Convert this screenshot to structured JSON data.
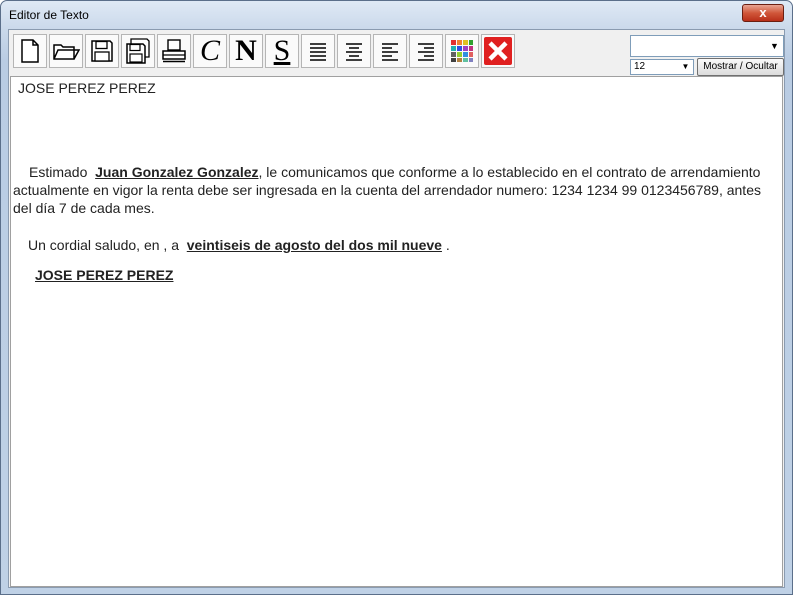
{
  "window": {
    "title": "Editor de Texto",
    "close_label": "x"
  },
  "toolbar": {
    "buttons": [
      {
        "name": "new-document",
        "icon": "new-document-icon"
      },
      {
        "name": "open",
        "icon": "open-folder-icon"
      },
      {
        "name": "save",
        "icon": "floppy-disk-icon"
      },
      {
        "name": "save-as",
        "icon": "save-as-icon"
      },
      {
        "name": "print",
        "icon": "printer-icon"
      },
      {
        "name": "italic",
        "glyph": "C"
      },
      {
        "name": "bold",
        "glyph": "N"
      },
      {
        "name": "underline",
        "glyph": "S"
      },
      {
        "name": "align-justify",
        "icon": "align-justify-icon"
      },
      {
        "name": "align-center",
        "icon": "align-center-icon"
      },
      {
        "name": "align-left",
        "icon": "align-left-icon"
      },
      {
        "name": "align-right",
        "icon": "align-right-icon"
      },
      {
        "name": "color",
        "icon": "color-palette-icon"
      },
      {
        "name": "close-document",
        "icon": "red-x-icon"
      }
    ],
    "font_name_value": "",
    "font_size_value": "12",
    "toggle_label": "Mostrar / Ocultar"
  },
  "document": {
    "sender": "JOSE PEREZ PEREZ",
    "greeting_prefix": "Estimado",
    "recipient": "Juan Gonzalez Gonzalez",
    "paragraph_rest": ", le comunicamos que conforme a lo establecido en el contrato de arrendamiento actualmente en vigor la renta debe ser ingresada en la cuenta del arrendador  numero: 1234 1234 99 0123456789,  antes del día 7 de cada mes.",
    "closing_prefix": "Un cordial saludo, en   , a",
    "date_text": "veintiseis de agosto del  dos mil nueve",
    "closing_suffix": ".",
    "signature": "JOSE PEREZ PEREZ"
  },
  "colors": {
    "accent_close": "#d0573a",
    "palette": [
      "#e03030",
      "#30a030",
      "#3050e0",
      "#e0c020",
      "#a040c0",
      "#20b0b0",
      "#f08030",
      "#606060"
    ]
  }
}
